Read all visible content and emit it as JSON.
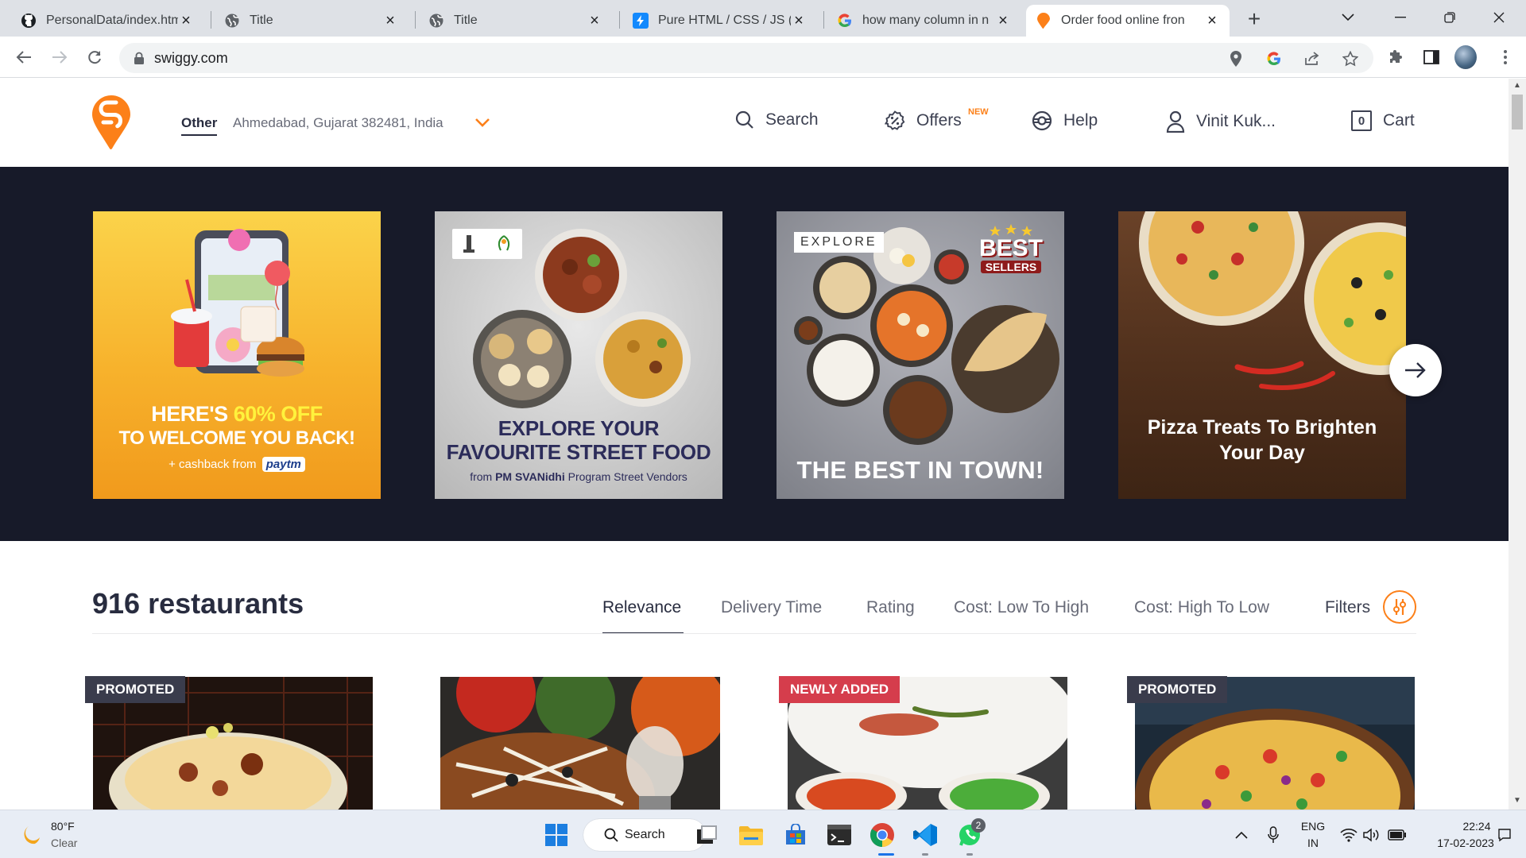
{
  "browser": {
    "tabs": [
      {
        "title": "PersonalData/index.htm",
        "icon": "github-icon"
      },
      {
        "title": "Title",
        "icon": "globe-icon"
      },
      {
        "title": "Title",
        "icon": "globe-icon"
      },
      {
        "title": "Pure HTML / CSS / JS (",
        "icon": "stackblitz-icon"
      },
      {
        "title": "how many column in n",
        "icon": "google-icon"
      },
      {
        "title": "Order food online fron",
        "icon": "swiggy-icon",
        "active": true
      }
    ],
    "url": "swiggy.com"
  },
  "header": {
    "location_label": "Other",
    "location_address": "Ahmedabad, Gujarat 382481, India",
    "nav": {
      "search": "Search",
      "offers": "Offers",
      "offers_badge": "NEW",
      "help": "Help",
      "user": "Vinit Kuk...",
      "cart": "Cart",
      "cart_count": "0"
    }
  },
  "carousel": {
    "banners": [
      {
        "line1": "HERE'S",
        "highlight": "60% OFF",
        "line2": "TO WELCOME YOU BACK!",
        "sub": "+ cashback from",
        "brand": "paytm"
      },
      {
        "line1": "EXPLORE YOUR",
        "line2": "FAVOURITE STREET FOOD",
        "sub_prefix": "from",
        "sub_bold": "PM SVANidhi",
        "sub_suffix": "Program Street Vendors"
      },
      {
        "tag": "EXPLORE",
        "badge_top": "BEST",
        "badge_bottom": "SELLERS",
        "line1": "THE BEST IN TOWN!"
      },
      {
        "line1": "Pizza Treats To Brighten",
        "line2": "Your Day"
      }
    ]
  },
  "listing": {
    "count": "916 restaurants",
    "sort_options": [
      "Relevance",
      "Delivery Time",
      "Rating",
      "Cost: Low To High",
      "Cost: High To Low"
    ],
    "active_sort": "Relevance",
    "filters_label": "Filters",
    "cards": [
      {
        "ribbon": "PROMOTED",
        "ribbon_color": "#3a3c4c"
      },
      {
        "ribbon": ""
      },
      {
        "ribbon": "NEWLY ADDED",
        "ribbon_color": "#d53d4c"
      },
      {
        "ribbon": "PROMOTED",
        "ribbon_color": "#3a3c4c"
      }
    ]
  },
  "taskbar": {
    "weather_temp": "80°F",
    "weather_desc": "Clear",
    "search_label": "Search",
    "whatsapp_badge": "2",
    "lang_top": "ENG",
    "lang_bottom": "IN",
    "time": "22:24",
    "date": "17-02-2023"
  },
  "colors": {
    "brand": "#fc8019",
    "carousel_bg": "#171a29",
    "text_dark": "#282c3f",
    "text_muted": "#686b78"
  }
}
